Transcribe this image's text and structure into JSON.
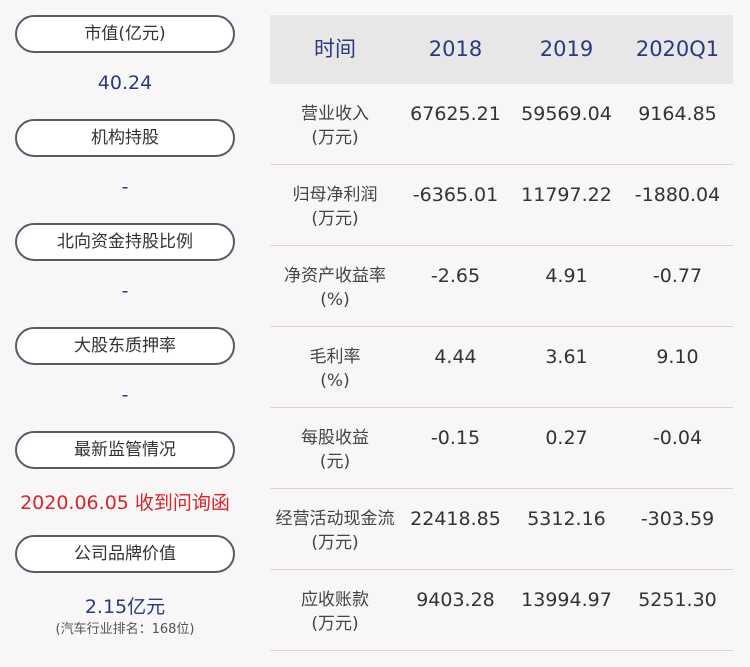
{
  "left": {
    "market_cap_label": "市值(亿元)",
    "market_cap_value": "40.24",
    "institution_label": "机构持股",
    "institution_value": "-",
    "northbound_label": "北向资金持股比例",
    "northbound_value": "-",
    "pledge_label": "大股东质押率",
    "pledge_value": "-",
    "regulatory_label": "最新监管情况",
    "regulatory_value": "2020.06.05 收到问询函",
    "brand_label": "公司品牌价值",
    "brand_value": "2.15亿元",
    "brand_rank": "(汽车行业排名：168位)"
  },
  "table": {
    "headers": [
      "时间",
      "2018",
      "2019",
      "2020Q1"
    ],
    "rows": [
      {
        "label1": "营业收入",
        "label2": "(万元)",
        "v2018": "67625.21",
        "v2019": "59569.04",
        "v2020q1": "9164.85"
      },
      {
        "label1": "归母净利润",
        "label2": "(万元)",
        "v2018": "-6365.01",
        "v2019": "11797.22",
        "v2020q1": "-1880.04"
      },
      {
        "label1": "净资产收益率",
        "label2": "(%)",
        "v2018": "-2.65",
        "v2019": "4.91",
        "v2020q1": "-0.77"
      },
      {
        "label1": "毛利率",
        "label2": "(%)",
        "v2018": "4.44",
        "v2019": "3.61",
        "v2020q1": "9.10"
      },
      {
        "label1": "每股收益",
        "label2": "(元)",
        "v2018": "-0.15",
        "v2019": "0.27",
        "v2020q1": "-0.04"
      },
      {
        "label1": "经营活动现金流",
        "label2": "(万元)",
        "v2018": "22418.85",
        "v2019": "5312.16",
        "v2020q1": "-303.59"
      },
      {
        "label1": "应收账款",
        "label2": "(万元)",
        "v2018": "9403.28",
        "v2019": "13994.97",
        "v2020q1": "5251.30"
      }
    ]
  },
  "colors": {
    "accent": "#2b3a7e",
    "alert": "#d6262b",
    "header_bg": "#e9e6e8",
    "page_bg": "#f8f6f7"
  }
}
